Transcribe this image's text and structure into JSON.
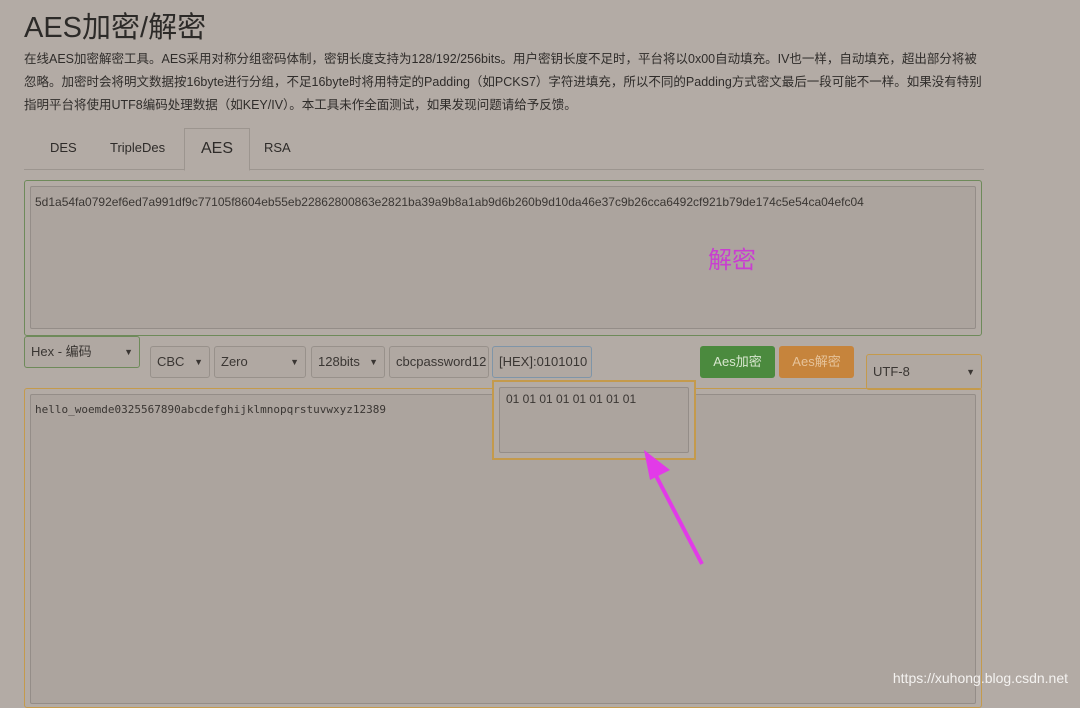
{
  "header": {
    "title": "AES加密/解密",
    "description": "在线AES加密解密工具。AES采用对称分组密码体制，密钥长度支持为128/192/256bits。用户密钥长度不足时，平台将以0x00自动填充。IV也一样，自动填充，超出部分将被忽略。加密时会将明文数据按16byte进行分组，不足16byte时将用特定的Padding（如PCKS7）字符进填充，所以不同的Padding方式密文最后一段可能不一样。如果没有特别指明平台将使用UTF8编码处理数据（如KEY/IV）。本工具未作全面测试，如果发现问题请给予反馈。"
  },
  "tabs": [
    {
      "label": "DES"
    },
    {
      "label": "TripleDes"
    },
    {
      "label": "AES",
      "active": true
    },
    {
      "label": "RSA"
    }
  ],
  "ciphertext": "5d1a54fa0792ef6ed7a991df9c77105f8604eb55eb22862800863e2821ba39a9b8a1ab9d6b260b9d10da46e37c9b26cca6492cf921b79de174c5e54ca04efc04",
  "annotation": "解密",
  "controls": {
    "output_format": "Hex - 编码",
    "mode": "CBC",
    "padding": "Zero",
    "key_size": "128bits",
    "key": "cbcpassword12",
    "iv": "[HEX]:0101010",
    "encrypt_label": "Aes加密",
    "decrypt_label": "Aes解密",
    "charset": "UTF-8"
  },
  "iv_popup": "01 01 01 01 01 01 01 01",
  "plaintext": "hello_woemde0325567890abcdefghijklmnopqrstuvwxyz12389",
  "watermark": "https://xuhong.blog.csdn.net",
  "colors": {
    "encrypt": "#4b8a3e",
    "decrypt": "#c6843c",
    "arrow": "#e23ae8"
  }
}
